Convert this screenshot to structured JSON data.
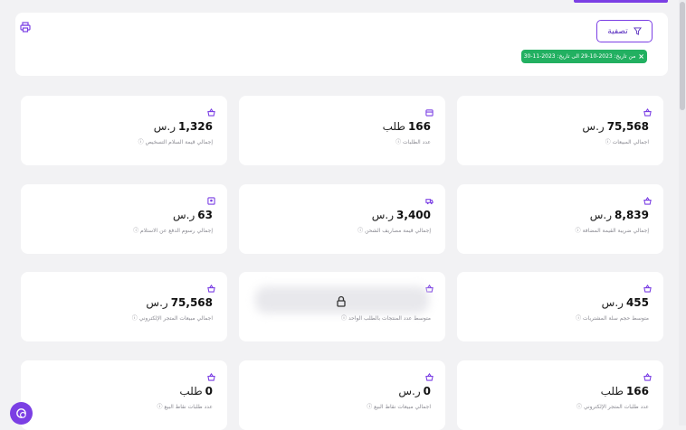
{
  "filter": {
    "button_label": "تصفية",
    "chip_text": "من تاريخ: 2023-10-29 الى تاريخ: 2023-11-30",
    "chip_close": "×"
  },
  "cards": [
    {
      "value": "75,568",
      "unit": "ر.س",
      "label": "اجمالي المبيعات ⓘ",
      "icon": "basket-icon"
    },
    {
      "value": "166",
      "unit": "طلب",
      "label": "عدد الطلبات ⓘ",
      "icon": "calendar-icon"
    },
    {
      "value": "1,326",
      "unit": "ر.س",
      "label": "إجمالي قيمة السلام التسخيص ⓘ",
      "icon": "basket-icon"
    },
    {
      "value": "8,839",
      "unit": "ر.س",
      "label": "إجمالي ضريبة القيمة المضافة ⓘ",
      "icon": "basket-icon"
    },
    {
      "value": "3,400",
      "unit": "ر.س",
      "label": "إجمالي قيمة مصاريف الشحن ⓘ",
      "icon": "truck-icon"
    },
    {
      "value": "63",
      "unit": "ر.س",
      "label": "إجمالي رسوم الدفع عن الاستلام ⓘ",
      "icon": "receipt-icon"
    },
    {
      "value": "455",
      "unit": "ر.س",
      "label": "متوسط حجم سلة المشتريات ⓘ",
      "icon": "basket-icon"
    },
    {
      "value": "",
      "unit": "",
      "label": "متوسط عدد المنتجات بالطلب الواحد ⓘ",
      "icon": "basket-icon",
      "locked": true
    },
    {
      "value": "75,568",
      "unit": "ر.س",
      "label": "اجمالي مبيعات المتجر الإلكتروني ⓘ",
      "icon": "basket-icon"
    },
    {
      "value": "166",
      "unit": "طلب",
      "label": "عدد طلبات المتجر الإلكتروني ⓘ",
      "icon": "basket-icon"
    },
    {
      "value": "0",
      "unit": "ر.س",
      "label": "اجمالي مبيعات نقاط البيع ⓘ",
      "icon": "basket-icon"
    },
    {
      "value": "0",
      "unit": "طلب",
      "label": "عدد طلبات نقاط البيع ⓘ",
      "icon": "basket-icon"
    }
  ],
  "colors": {
    "accent": "#7b3fe4",
    "chip": "#22b061"
  }
}
